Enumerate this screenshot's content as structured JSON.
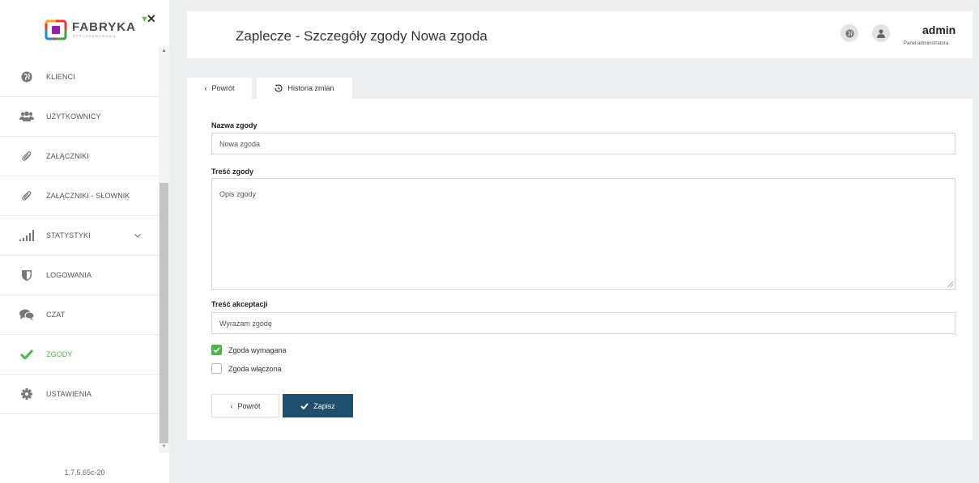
{
  "logo": {
    "text": "FABRYKA",
    "subtext": "OPROGRAMOWANIA"
  },
  "sidebar": {
    "items": [
      {
        "label": "KLIENCI",
        "icon": "globe-icon"
      },
      {
        "label": "UŻYTKOWNICY",
        "icon": "users-icon"
      },
      {
        "label": "ZAŁĄCZNIKI",
        "icon": "paperclip-icon"
      },
      {
        "label": "ZAŁĄCZNIKI - SŁOWNIK",
        "icon": "paperclip-icon"
      },
      {
        "label": "STATYSTYKI",
        "icon": "signal-bars-icon",
        "expandable": true
      },
      {
        "label": "LOGOWANIA",
        "icon": "shield-icon"
      },
      {
        "label": "CZAT",
        "icon": "chat-icon"
      },
      {
        "label": "ZGODY",
        "icon": "check-icon",
        "active": true
      },
      {
        "label": "USTAWIENIA",
        "icon": "gear-icon"
      }
    ],
    "version": "1.7.5.65c-20"
  },
  "header": {
    "title": "Zaplecze - Szczegóły zgody Nowa zgoda",
    "user_name": "admin",
    "user_role": "Panel administratora"
  },
  "tabs": {
    "back": "Powrót",
    "history": "Historia zmian"
  },
  "form": {
    "name_label": "Nazwa zgody",
    "name_value": "Nowa zgoda",
    "content_label": "Treść zgody",
    "content_value": "Opis zgody",
    "accept_label": "Treść akceptacji",
    "accept_value": "Wyrażam zgodę",
    "required_label": "Zgoda wymagana",
    "required_checked": true,
    "enabled_label": "Zgoda włączona",
    "enabled_checked": false,
    "back_button": "Powrót",
    "save_button": "Zapisz"
  },
  "colors": {
    "accent_green": "#4cb748",
    "primary_button": "#1f4e6e"
  }
}
